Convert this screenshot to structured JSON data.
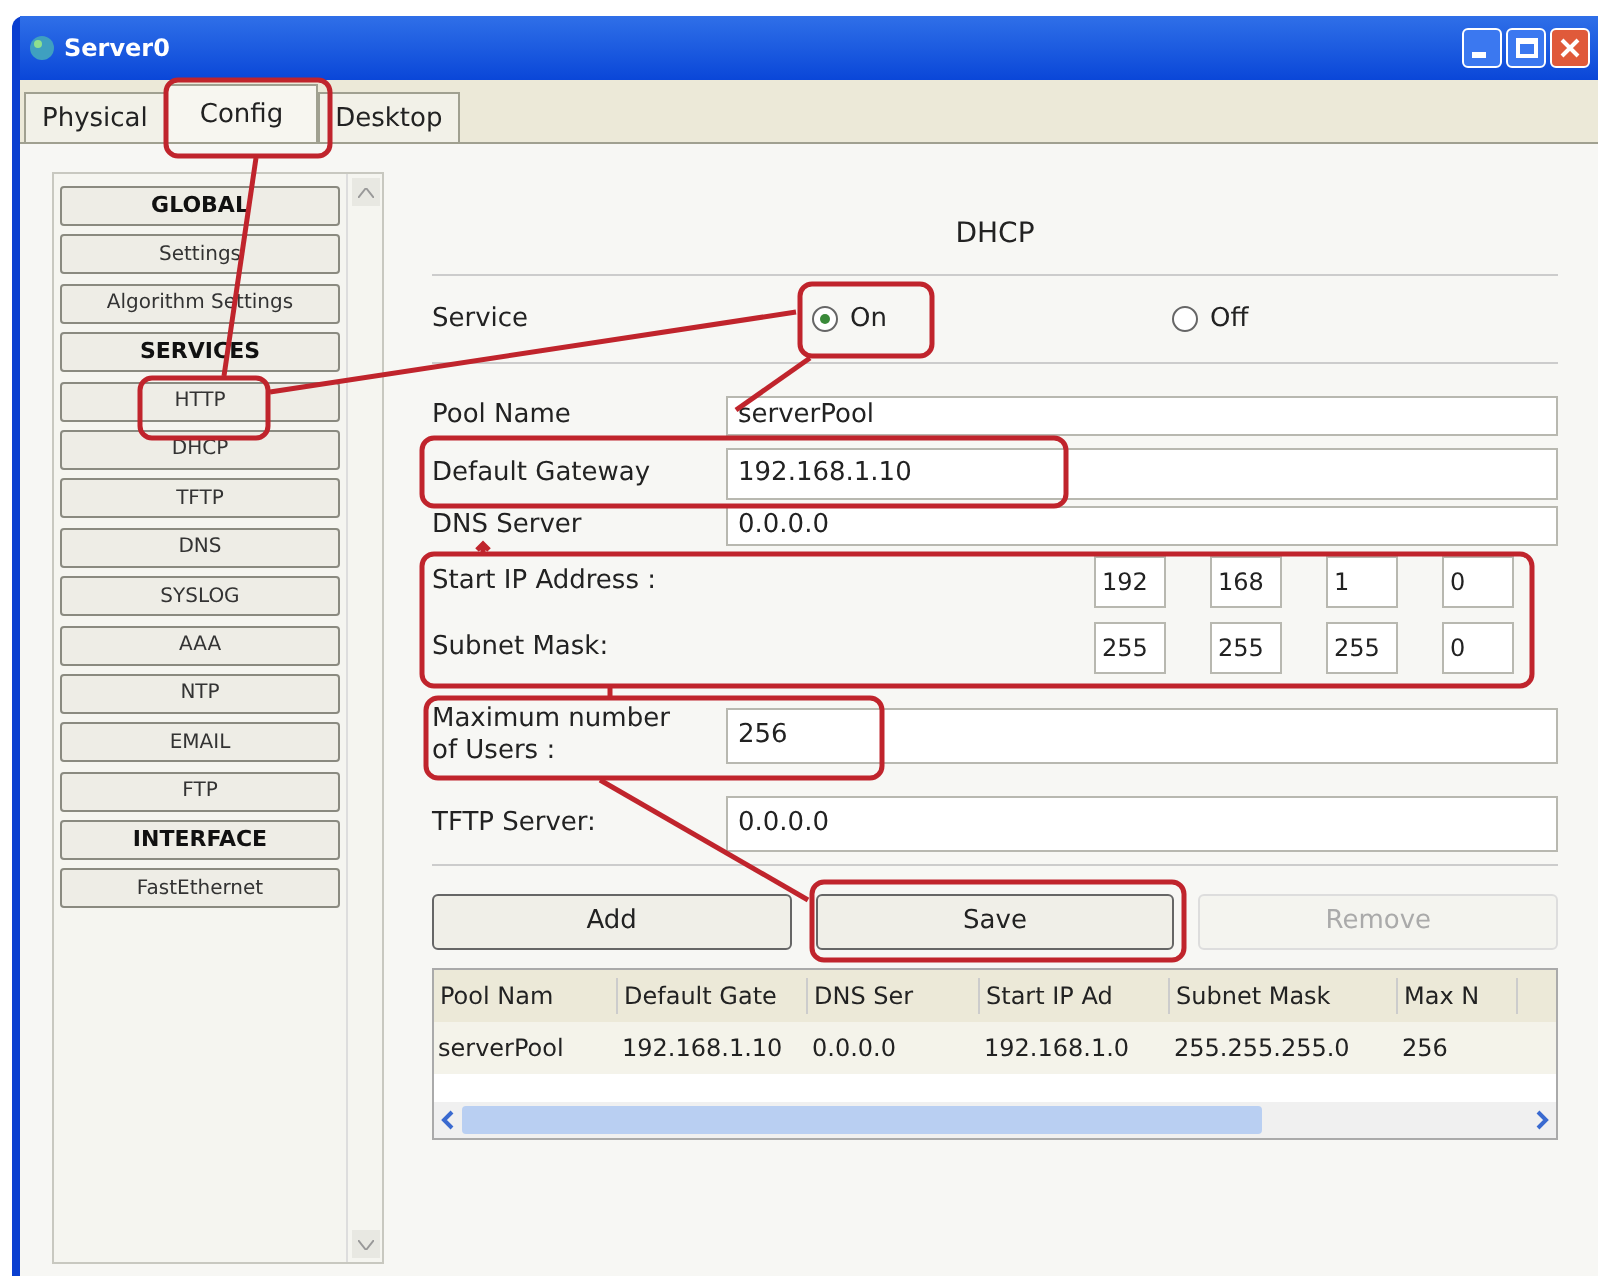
{
  "window": {
    "title": "Server0"
  },
  "tabs": [
    {
      "label": "Physical",
      "selected": false
    },
    {
      "label": "Config",
      "selected": true
    },
    {
      "label": "Desktop",
      "selected": false
    }
  ],
  "sidebar": {
    "items": [
      {
        "label": "GLOBAL",
        "kind": "header"
      },
      {
        "label": "Settings",
        "kind": "item"
      },
      {
        "label": "Algorithm Settings",
        "kind": "item"
      },
      {
        "label": "SERVICES",
        "kind": "header"
      },
      {
        "label": "HTTP",
        "kind": "item"
      },
      {
        "label": "DHCP",
        "kind": "item"
      },
      {
        "label": "TFTP",
        "kind": "item"
      },
      {
        "label": "DNS",
        "kind": "item"
      },
      {
        "label": "SYSLOG",
        "kind": "item"
      },
      {
        "label": "AAA",
        "kind": "item"
      },
      {
        "label": "NTP",
        "kind": "item"
      },
      {
        "label": "EMAIL",
        "kind": "item"
      },
      {
        "label": "FTP",
        "kind": "item"
      },
      {
        "label": "INTERFACE",
        "kind": "header"
      },
      {
        "label": "FastEthernet",
        "kind": "item"
      }
    ]
  },
  "panel": {
    "title": "DHCP",
    "service": {
      "label": "Service",
      "options": [
        {
          "label": "On",
          "selected": true
        },
        {
          "label": "Off",
          "selected": false
        }
      ]
    },
    "fields": [
      {
        "label": "Pool Name",
        "value": "serverPool"
      },
      {
        "label": "Default Gateway",
        "value": "192.168.1.10"
      },
      {
        "label": "DNS Server",
        "value": "0.0.0.0"
      }
    ],
    "octet_rows": [
      {
        "label": "Start IP Address :",
        "octets": [
          "192",
          "168",
          "1",
          "0"
        ]
      },
      {
        "label": "Subnet Mask:",
        "octets": [
          "255",
          "255",
          "255",
          "0"
        ]
      }
    ],
    "more_fields": [
      {
        "label": "Maximum number of Users :",
        "value": "256"
      },
      {
        "label": "TFTP Server:",
        "value": "0.0.0.0"
      }
    ],
    "buttons": [
      {
        "label": "Add",
        "disabled": false
      },
      {
        "label": "Save",
        "disabled": false
      },
      {
        "label": "Remove",
        "disabled": true
      }
    ],
    "table": {
      "columns": [
        "Pool Nam",
        "Default Gate",
        "DNS Ser",
        "Start IP Ad",
        "Subnet Mask",
        "Max N"
      ],
      "rows": [
        [
          "serverPool",
          "192.168.1.10",
          "0.0.0.0",
          "192.168.1.0",
          "255.255.255.0",
          "256"
        ]
      ]
    }
  }
}
